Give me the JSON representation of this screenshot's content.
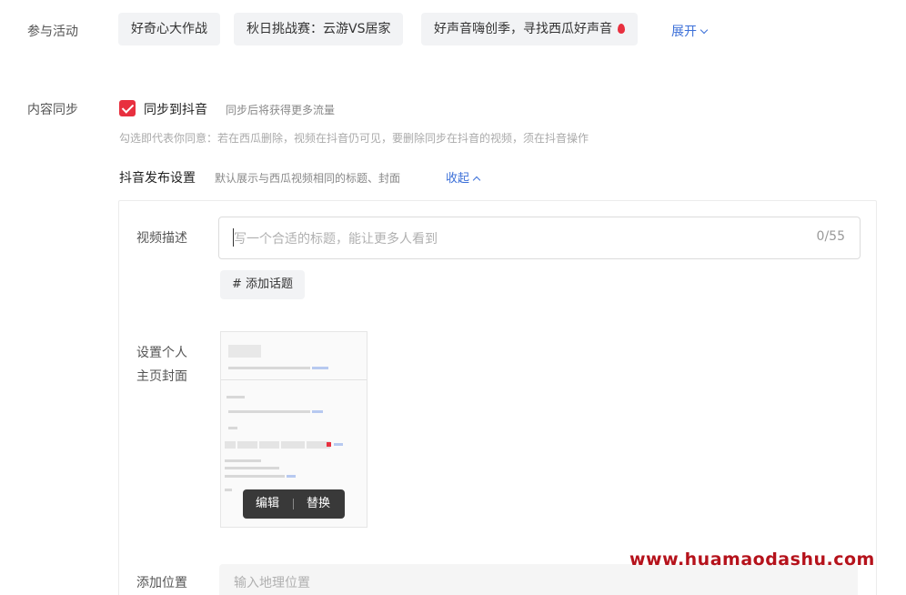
{
  "activity": {
    "label": "参与活动",
    "chips": [
      {
        "label": "好奇心大作战"
      },
      {
        "label": "秋日挑战赛：云游VS居家"
      },
      {
        "label": "好声音嗨创季，寻找西瓜好声音"
      }
    ],
    "fire_icon": "fire-icon",
    "expand_label": "展开"
  },
  "sync": {
    "label": "内容同步",
    "checked": true,
    "checkbox_label": "同步到抖音",
    "hint": "同步后将获得更多流量",
    "note": "勾选即代表你同意：若在西瓜删除，视频在抖音仍可见，要删除同步在抖音的视频，须在抖音操作"
  },
  "douyin": {
    "title": "抖音发布设置",
    "hint": "默认展示与西瓜视频相同的标题、封面",
    "collapse_label": "收起",
    "desc_label": "视频描述",
    "desc_placeholder": "写一个合适的标题，能让更多人看到",
    "desc_count": "0/55",
    "topic_button": "# 添加话题",
    "cover_label_1": "设置个人",
    "cover_label_2": "主页封面",
    "cover_edit": "编辑",
    "cover_replace": "替换",
    "location_label": "添加位置",
    "location_placeholder": "输入地理位置"
  },
  "watermark": "www.huamaodashu.com",
  "colors": {
    "accent_red": "#e8303f",
    "link_blue": "#3b6fd8",
    "watermark": "#b5121b"
  }
}
